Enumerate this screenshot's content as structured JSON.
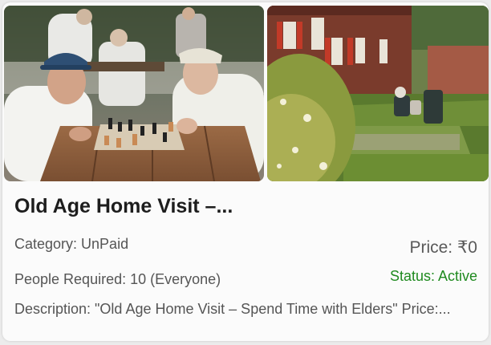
{
  "card": {
    "title": "Old Age Home Visit –...",
    "category": "Category: UnPaid",
    "people_required": "People Required: 10 (Everyone)",
    "description": "Description: \"Old Age Home Visit – Spend Time with Elders\" Price:...",
    "price": "Price: ₹0",
    "status": "Status: Active",
    "status_color": "#1f8a1f"
  },
  "photos": [
    {
      "semantic": "elderly-men-playing-chess-photo"
    },
    {
      "semantic": "garden-with-elders-photo"
    }
  ]
}
